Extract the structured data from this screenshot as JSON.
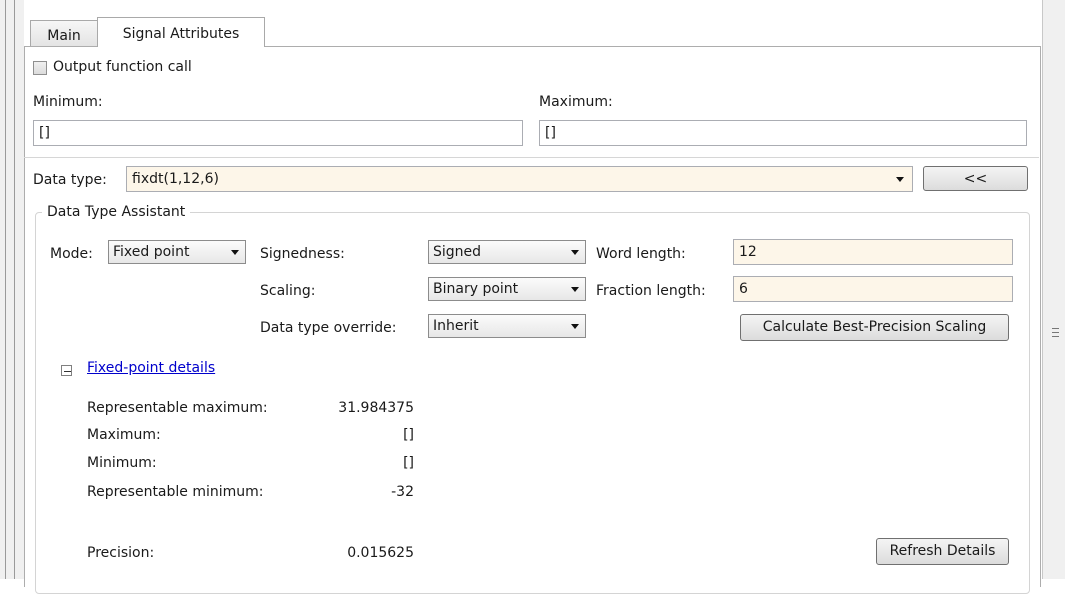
{
  "tabs": [
    {
      "label": "Main",
      "active": false
    },
    {
      "label": "Signal Attributes",
      "active": true
    }
  ],
  "output_function_call": {
    "label": "Output function call",
    "checked": false
  },
  "minimum": {
    "label": "Minimum:",
    "value": "[]"
  },
  "maximum": {
    "label": "Maximum:",
    "value": "[]"
  },
  "data_type": {
    "label": "Data type:",
    "value": "fixdt(1,12,6)",
    "toggle_label": "<<"
  },
  "assistant": {
    "title": "Data Type Assistant",
    "mode_label": "Mode:",
    "mode_value": "Fixed point",
    "signedness_label": "Signedness:",
    "signedness_value": "Signed",
    "word_length_label": "Word length:",
    "word_length_value": "12",
    "scaling_label": "Scaling:",
    "scaling_value": "Binary point",
    "fraction_length_label": "Fraction length:",
    "fraction_length_value": "6",
    "override_label": "Data type override:",
    "override_value": "Inherit",
    "calc_button": "Calculate Best-Precision Scaling"
  },
  "details": {
    "toggle_label": "Fixed-point details",
    "expanded": true,
    "rows": [
      {
        "label": "Representable maximum:",
        "value": "31.984375"
      },
      {
        "label": "Maximum:",
        "value": "[]"
      },
      {
        "label": "Minimum:",
        "value": "[]"
      },
      {
        "label": "Representable minimum:",
        "value": "-32"
      }
    ],
    "precision_label": "Precision:",
    "precision_value": "0.015625",
    "refresh_button": "Refresh Details"
  },
  "colors": {
    "tinted_field": "#fdf6e9",
    "link": "#0000cc"
  },
  "icons": [
    "checkbox-icon",
    "dropdown-arrow-icon",
    "collapse-minus-icon",
    "scroll-grip-icon"
  ]
}
